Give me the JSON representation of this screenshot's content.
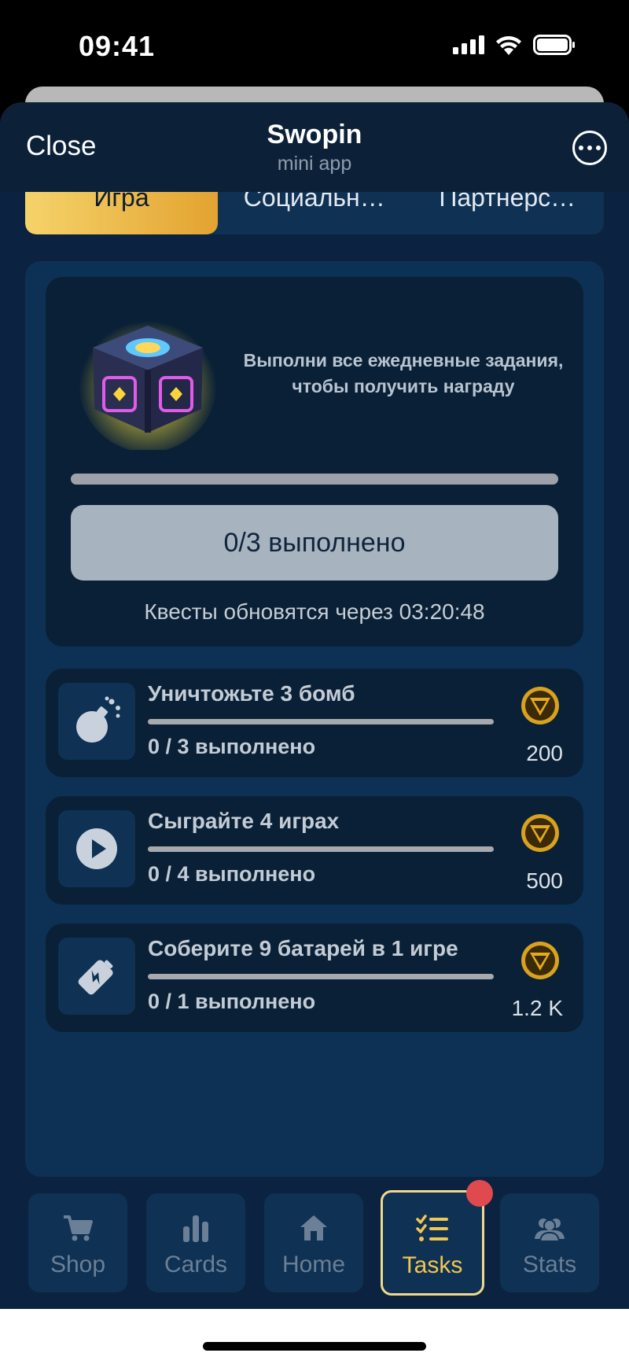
{
  "status_bar": {
    "time": "09:41"
  },
  "header": {
    "close_label": "Close",
    "title": "Swopin",
    "subtitle": "mini app"
  },
  "tabs": [
    {
      "label": "Игра",
      "active": true
    },
    {
      "label": "Социальн…",
      "active": false
    },
    {
      "label": "Партнерс…",
      "active": false
    }
  ],
  "daily_reward": {
    "description": "Выполни все ежедневные задания, чтобы получить награду",
    "progress_fraction": 0,
    "button_label": "0/3 выполнено",
    "refresh_text": "Квесты обновятся через 03:20:48"
  },
  "tasks": [
    {
      "icon": "bomb-icon",
      "title": "Уничтожьте 3 бомб",
      "progress_text": "0 / 3 выполнено",
      "progress_fraction": 0,
      "reward": "200"
    },
    {
      "icon": "play-icon",
      "title": "Сыграйте 4 играх",
      "progress_text": "0 / 4 выполнено",
      "progress_fraction": 0,
      "reward": "500"
    },
    {
      "icon": "battery-icon",
      "title": "Соберите 9 батарей в 1 игре",
      "progress_text": "0 / 1 выполнено",
      "progress_fraction": 0,
      "reward": "1.2 K"
    }
  ],
  "nav": [
    {
      "label": "Shop",
      "icon": "cart-icon",
      "active": false
    },
    {
      "label": "Cards",
      "icon": "bar-chart-icon",
      "active": false
    },
    {
      "label": "Home",
      "icon": "home-icon",
      "active": false
    },
    {
      "label": "Tasks",
      "icon": "checklist-icon",
      "active": true
    },
    {
      "label": "Stats",
      "icon": "users-icon",
      "active": false
    }
  ],
  "colors": {
    "accent": "#f1c651",
    "background": "#0b2340",
    "badge": "#e04a4f"
  }
}
